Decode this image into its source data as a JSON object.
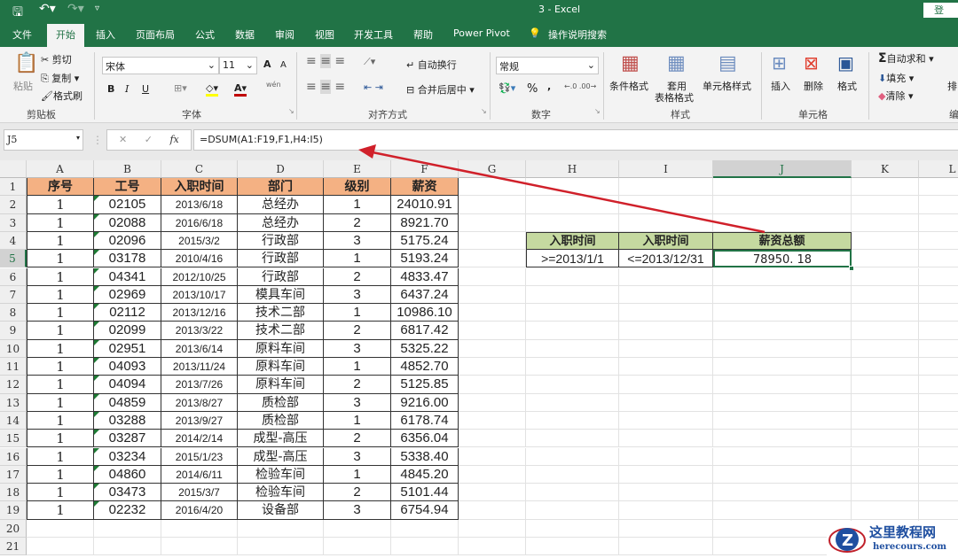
{
  "title": "3  -  Excel",
  "login": "登",
  "quick_access": [
    "save-icon",
    "undo-icon",
    "redo-icon",
    "customize-icon"
  ],
  "tabs": [
    "文件",
    "开始",
    "插入",
    "页面布局",
    "公式",
    "数据",
    "审阅",
    "视图",
    "开发工具",
    "帮助",
    "Power Pivot",
    "操作说明搜索"
  ],
  "ribbon": {
    "clipboard": {
      "paste": "粘贴",
      "cut": "剪切",
      "copy": "复制",
      "format_painter": "格式刷",
      "label": "剪贴板"
    },
    "font": {
      "name": "宋体",
      "size": "11",
      "bold": "B",
      "italic": "I",
      "underline": "U",
      "grow": "A",
      "shrink": "A",
      "label": "字体",
      "phonetic": "wén"
    },
    "alignment": {
      "wrap": "自动换行",
      "merge": "合并后居中",
      "label": "对齐方式"
    },
    "number": {
      "format": "常规",
      "percent": "%",
      "comma": ",",
      "label": "数字"
    },
    "styles": {
      "conditional": "条件格式",
      "table": "套用表格格式",
      "table1": "套用",
      "table2": "表格格式",
      "cell": "单元格样式",
      "label": "样式"
    },
    "cells": {
      "insert": "插入",
      "delete": "删除",
      "format": "格式",
      "label": "单元格"
    },
    "editing": {
      "autosum": "自动求和",
      "fill": "填充",
      "clear": "清除",
      "sort": "排",
      "label": "编"
    }
  },
  "name_box": "J5",
  "formula": "=DSUM(A1:F19,F1,H4:I5)",
  "fx": "fx",
  "columns": [
    "A",
    "B",
    "C",
    "D",
    "E",
    "F",
    "G",
    "H",
    "I",
    "J",
    "K",
    "L"
  ],
  "rows": [
    "1",
    "2",
    "3",
    "4",
    "5",
    "6",
    "7",
    "8",
    "9",
    "10",
    "11",
    "12",
    "13",
    "14",
    "15",
    "16",
    "17",
    "18",
    "19",
    "20",
    "21"
  ],
  "table": {
    "headers": [
      "序号",
      "工号",
      "入职时间",
      "部门",
      "级别",
      "薪资"
    ],
    "rows": [
      [
        "1",
        "02105",
        "2013/6/18",
        "总经办",
        "1",
        "24010.91"
      ],
      [
        "1",
        "02088",
        "2016/6/18",
        "总经办",
        "2",
        "8921.70"
      ],
      [
        "1",
        "02096",
        "2015/3/2",
        "行政部",
        "3",
        "5175.24"
      ],
      [
        "1",
        "03178",
        "2010/4/16",
        "行政部",
        "1",
        "5193.24"
      ],
      [
        "1",
        "04341",
        "2012/10/25",
        "行政部",
        "2",
        "4833.47"
      ],
      [
        "1",
        "02969",
        "2013/10/17",
        "模具车间",
        "3",
        "6437.24"
      ],
      [
        "1",
        "02112",
        "2013/12/16",
        "技术二部",
        "1",
        "10986.10"
      ],
      [
        "1",
        "02099",
        "2013/3/22",
        "技术二部",
        "2",
        "6817.42"
      ],
      [
        "1",
        "02951",
        "2013/6/14",
        "原料车间",
        "3",
        "5325.22"
      ],
      [
        "1",
        "04093",
        "2013/11/24",
        "原料车间",
        "1",
        "4852.70"
      ],
      [
        "1",
        "04094",
        "2013/7/26",
        "原料车间",
        "2",
        "5125.85"
      ],
      [
        "1",
        "04859",
        "2013/8/27",
        "质检部",
        "3",
        "9216.00"
      ],
      [
        "1",
        "03288",
        "2013/9/27",
        "质检部",
        "1",
        "6178.74"
      ],
      [
        "1",
        "03287",
        "2014/2/14",
        "成型-高压",
        "2",
        "6356.04"
      ],
      [
        "1",
        "03234",
        "2015/1/23",
        "成型-高压",
        "3",
        "5338.40"
      ],
      [
        "1",
        "04860",
        "2014/6/11",
        "检验车间",
        "1",
        "4845.20"
      ],
      [
        "1",
        "03473",
        "2015/3/7",
        "检验车间",
        "2",
        "5101.44"
      ],
      [
        "1",
        "02232",
        "2016/4/20",
        "设备部",
        "3",
        "6754.94"
      ]
    ]
  },
  "criteria": {
    "headers": [
      "入职时间",
      "入职时间",
      "薪资总额"
    ],
    "values": [
      ">=2013/1/1",
      "<=2013/12/31",
      "78950. 18"
    ]
  },
  "watermark": {
    "name": "这里教程网",
    "url": "herecours.com"
  },
  "colors": {
    "excel_green": "#217346",
    "header_orange": "#f4b183",
    "criteria_green": "#c5d9a0",
    "arrow": "#d0202a"
  }
}
